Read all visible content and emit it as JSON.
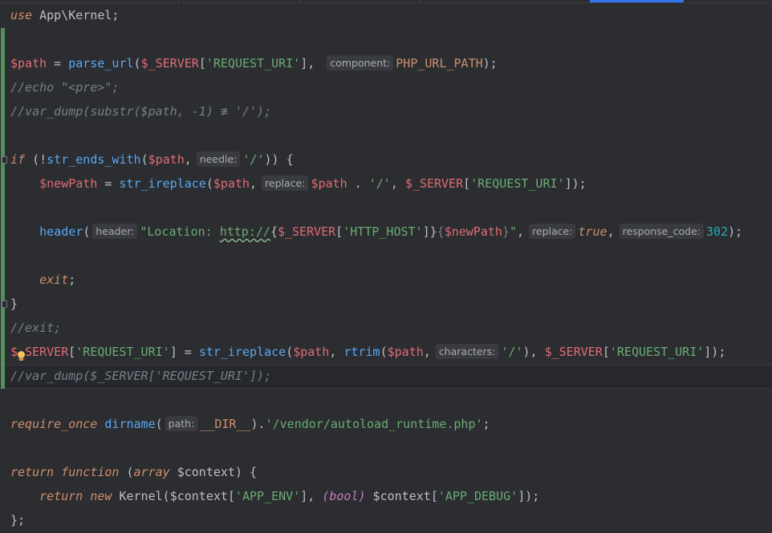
{
  "colors": {
    "background": "#2b2d30",
    "keyword": "#cf8e6d",
    "function": "#56a8f5",
    "variable": "#c77dbb",
    "string": "#6aab73",
    "number": "#2aacb8",
    "comment": "#7a7e85",
    "change_marker": "#549159",
    "active_tab": "#3574f0"
  },
  "icons": [
    "fold-icon",
    "intention-bulb-icon"
  ],
  "code": {
    "l1": {
      "use": "use",
      "ns": " App\\Kernel;"
    },
    "l3": {
      "path": "$path",
      "eq": " = ",
      "fn": "parse_url",
      "open": "(",
      "server": "$_SERVER",
      "b1": "[",
      "key": "'REQUEST_URI'",
      "b2": "], ",
      "hint": "component:",
      "const": "PHP_URL_PATH",
      "end": ");"
    },
    "l4": {
      "comment": "//echo \"<pre>\";"
    },
    "l5": {
      "comment": "//var_dump(substr($path, -1) ≢ '/');"
    },
    "l7": {
      "if": "if",
      "open": " (!",
      "fn": "str_ends_with",
      "p": "(",
      "path": "$path",
      "comma": ",",
      "hint": "needle:",
      "str": "'/'",
      "end": ")) {"
    },
    "l8": {
      "indent": "    ",
      "newpath": "$newPath",
      "eq": " = ",
      "fn": "str_ireplace",
      "p": "(",
      "path": "$path",
      "comma": ",",
      "hint": "replace:",
      "path2": "$path",
      "dot": " . ",
      "str": "'/'",
      "comma2": ", ",
      "server": "$_SERVER",
      "b1": "[",
      "key": "'REQUEST_URI'",
      "end": "]);"
    },
    "l10": {
      "indent": "    ",
      "fn": "header",
      "p": "(",
      "hint1": "header:",
      "str1": "\"Location: ",
      "link": "http://",
      "brace1": "{",
      "server": "$_SERVER",
      "b1": "[",
      "key": "'HTTP_HOST'",
      "b2": "]",
      "brace2": "}",
      "brace3": "{",
      "newpath": "$newPath",
      "brace4": "}",
      "str2": "\"",
      "comma": ",",
      "hint2": "replace:",
      "true": "true",
      "comma2": ",",
      "hint3": "response_code:",
      "num": "302",
      "end": ");"
    },
    "l12": {
      "indent": "    ",
      "exit": "exit",
      "end": ";"
    },
    "l13": {
      "brace": "}"
    },
    "l14": {
      "comment": "//exit;"
    },
    "l15": {
      "server": "$_SERVER",
      "b1": "[",
      "key": "'REQUEST_URI'",
      "b2": "] = ",
      "fn": "str_ireplace",
      "p": "(",
      "path": "$path",
      "comma": ", ",
      "fn2": "rtrim",
      "p2": "(",
      "path2": "$path",
      "comma2": ",",
      "hint": "characters:",
      "str": "'/'",
      "close": "), ",
      "server2": "$_SERVER",
      "b3": "[",
      "key2": "'REQUEST_URI'",
      "end": "]);"
    },
    "l16": {
      "comment": "//var_dump($_SERVER['REQUEST_URI']);"
    },
    "l18": {
      "req": "require_once",
      "sp": " ",
      "fn": "dirname",
      "p": "(",
      "hint": "path:",
      "const": "__DIR__",
      "close": ").",
      "str": "'/vendor/autoload_runtime.php'",
      "end": ";"
    },
    "l20": {
      "ret": "return",
      "sp": " ",
      "func": "function",
      "open": " (",
      "array": "array",
      "ctx": " $context",
      "end": ") {"
    },
    "l21": {
      "indent": "    ",
      "ret": "return",
      "sp": " ",
      "new": "new",
      "cls": " Kernel(",
      "ctx": "$context",
      "b1": "[",
      "key": "'APP_ENV'",
      "b2": "], ",
      "cast": "(bool)",
      "ctx2": " $context",
      "b3": "[",
      "key2": "'APP_DEBUG'",
      "end": "]);"
    },
    "l22": {
      "end": "};"
    }
  }
}
